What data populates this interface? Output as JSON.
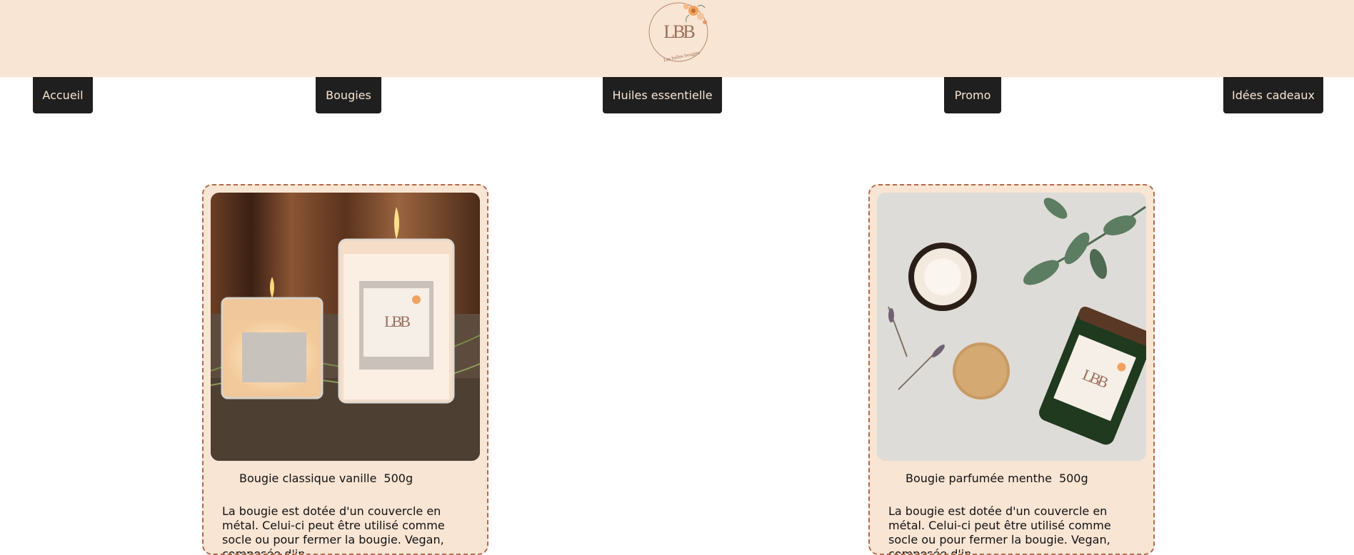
{
  "header": {
    "logo": {
      "icon": "lbb-logo-icon",
      "monogram": "LBB",
      "subtitle": "Les belles bougies"
    }
  },
  "nav": {
    "items": [
      {
        "label": "Accueil"
      },
      {
        "label": "Bougies"
      },
      {
        "label": "Huiles essentielle"
      },
      {
        "label": "Promo"
      },
      {
        "label": "Idées cadeaux"
      }
    ]
  },
  "products": [
    {
      "name": "Bougie classique vanille",
      "weight": "500g",
      "description": "La bougie est dotée d'un couvercle en métal. Celui-ci peut être utilisé comme socle ou pour fermer la bougie. Vegan, composée d'in"
    },
    {
      "name": "Bougie parfumée menthe",
      "weight": "500g",
      "description": "La bougie est dotée d'un couvercle en métal. Celui-ci peut être utilisé comme socle ou pour fermer la bougie. Vegan, composée d'in"
    }
  ],
  "colors": {
    "header_bg": "#f9e5d3",
    "nav_bg": "#1f1f1f",
    "card_border": "#b06a4e"
  }
}
